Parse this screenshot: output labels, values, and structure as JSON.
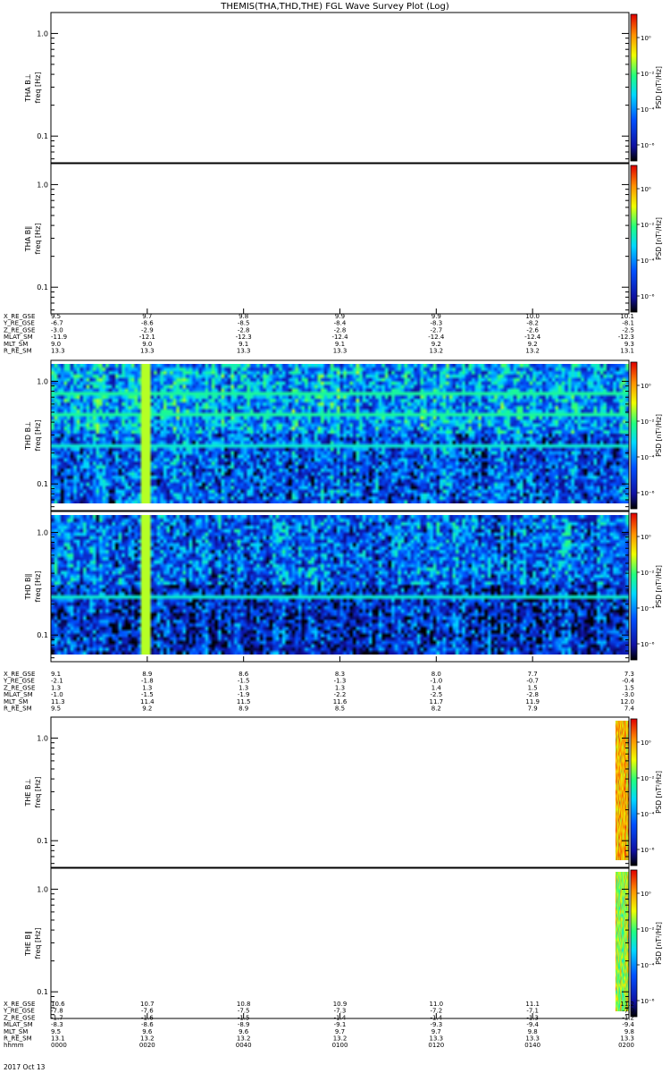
{
  "chart_data": {
    "type": "heatmap",
    "title": "THEMIS(THA,THD,THE) FGL Wave Survey Plot (Log)",
    "date": "2017 Oct 13",
    "yaxis": {
      "label": "freq [Hz]",
      "scale": "log",
      "range": [
        0.055,
        1.6
      ],
      "ticks": [
        "1.0",
        "0.1"
      ]
    },
    "colorbar": {
      "label": "PSD [nT²/Hz]",
      "scale": "log",
      "ticks": [
        "10⁰",
        "10⁻²",
        "10⁻⁴",
        "10⁻⁶"
      ],
      "colors": [
        "#000000",
        "#1010a0",
        "#0050ff",
        "#00d8ff",
        "#20ff80",
        "#f0ff00",
        "#ff9000",
        "#e00000"
      ]
    },
    "panels": [
      {
        "probe": "THA",
        "label": "THA B⊥",
        "data_start": null,
        "level": 0
      },
      {
        "probe": "THA",
        "label": "THA B∥",
        "data_start": null,
        "level": 0
      },
      {
        "probe": "THD",
        "label": "THD B⊥",
        "data_start": 0.0,
        "level": 0.33,
        "noise": 0.22
      },
      {
        "probe": "THD",
        "label": "THD B∥",
        "data_start": 0.0,
        "level": 0.24,
        "noise": 0.22
      },
      {
        "probe": "THE",
        "label": "THE B⊥",
        "data_start": 0.845,
        "level": 0.8,
        "noise": 0.12
      },
      {
        "probe": "THE",
        "label": "THE B∥",
        "data_start": 0.845,
        "level": 0.68,
        "noise": 0.14
      }
    ],
    "ephemeris": [
      {
        "probe": "THA",
        "rows": [
          {
            "label": "X_RE_GSE",
            "values": [
              "9.5",
              "9.7",
              "9.8",
              "9.9",
              "9.9",
              "10.0",
              "10.1"
            ]
          },
          {
            "label": "Y_RE_GSE",
            "values": [
              "-6.7",
              "-8.6",
              "-8.5",
              "-8.4",
              "-8.3",
              "-8.2",
              "-8.1"
            ]
          },
          {
            "label": "Z_RE_GSE",
            "values": [
              "-3.0",
              "-2.9",
              "-2.8",
              "-2.8",
              "-2.7",
              "-2.6",
              "-2.5"
            ]
          },
          {
            "label": "MLAT_SM",
            "values": [
              "-11.9",
              "-12.1",
              "-12.3",
              "-12.4",
              "-12.4",
              "-12.4",
              "-12.3"
            ]
          },
          {
            "label": "MLT_SM",
            "values": [
              "9.0",
              "9.0",
              "9.1",
              "9.1",
              "9.2",
              "9.2",
              "9.3"
            ]
          },
          {
            "label": "R_RE_SM",
            "values": [
              "13.3",
              "13.3",
              "13.3",
              "13.3",
              "13.2",
              "13.2",
              "13.1"
            ]
          }
        ]
      },
      {
        "probe": "THD",
        "rows": [
          {
            "label": "X_RE_GSE",
            "values": [
              "9.1",
              "8.9",
              "8.6",
              "8.3",
              "8.0",
              "7.7",
              "7.3"
            ]
          },
          {
            "label": "Y_RE_GSE",
            "values": [
              "-2.1",
              "-1.8",
              "-1.5",
              "-1.3",
              "-1.0",
              "-0.7",
              "-0.4"
            ]
          },
          {
            "label": "Z_RE_GSE",
            "values": [
              "1.3",
              "1.3",
              "1.3",
              "1.3",
              "1.4",
              "1.5",
              "1.5"
            ]
          },
          {
            "label": "MLAT_SM",
            "values": [
              "-1.0",
              "-1.5",
              "-1.9",
              "-2.2",
              "-2.5",
              "-2.8",
              "-3.0"
            ]
          },
          {
            "label": "MLT_SM",
            "values": [
              "11.3",
              "11.4",
              "11.5",
              "11.6",
              "11.7",
              "11.9",
              "12.0"
            ]
          },
          {
            "label": "R_RE_SM",
            "values": [
              "9.5",
              "9.2",
              "8.9",
              "8.5",
              "8.2",
              "7.9",
              "7.4"
            ]
          }
        ]
      },
      {
        "probe": "THE",
        "rows": [
          {
            "label": "X_RE_GSE",
            "values": [
              "10.6",
              "10.7",
              "10.8",
              "10.9",
              "11.0",
              "11.1",
              "11.2"
            ]
          },
          {
            "label": "Y_RE_GSE",
            "values": [
              "-7.8",
              "-7.6",
              "-7.5",
              "-7.3",
              "-7.2",
              "-7.1",
              "-7.0"
            ]
          },
          {
            "label": "Z_RE_GSE",
            "values": [
              "-1.7",
              "-1.6",
              "-1.5",
              "-1.4",
              "-1.4",
              "-1.3",
              "-1.2"
            ]
          },
          {
            "label": "MLAT_SM",
            "values": [
              "-8.3",
              "-8.6",
              "-8.9",
              "-9.1",
              "-9.3",
              "-9.4",
              "-9.4"
            ]
          },
          {
            "label": "MLT_SM",
            "values": [
              "9.5",
              "9.6",
              "9.6",
              "9.7",
              "9.7",
              "9.8",
              "9.8"
            ]
          },
          {
            "label": "R_RE_SM",
            "values": [
              "13.1",
              "13.2",
              "13.2",
              "13.2",
              "13.3",
              "13.3",
              "13.3"
            ]
          },
          {
            "label": "hhmm",
            "values": [
              "0000",
              "0020",
              "0040",
              "0100",
              "0120",
              "0140",
              "0200"
            ]
          }
        ]
      }
    ]
  }
}
